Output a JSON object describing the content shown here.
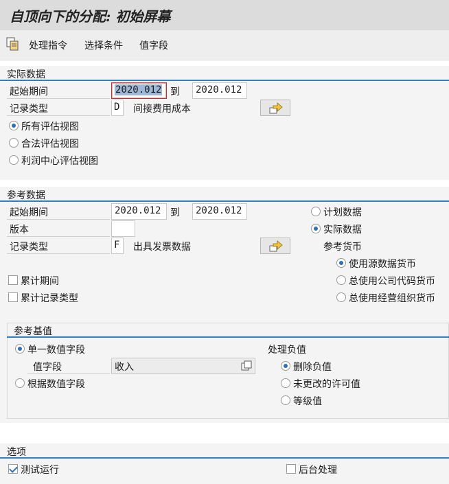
{
  "title": "自顶向下的分配: 初始屏幕",
  "toolbar": {
    "items": [
      "处理指令",
      "选择条件",
      "值字段"
    ]
  },
  "actual": {
    "header": "实际数据",
    "period_label": "起始期间",
    "period_from": "2020.012",
    "to_label": "到",
    "period_to": "2020.012",
    "record_type_label": "记录类型",
    "record_type_value": "D",
    "record_type_desc": "间接费用成本",
    "views": [
      "所有评估视图",
      "合法评估视图",
      "利润中心评估视图"
    ]
  },
  "reference": {
    "header": "参考数据",
    "period_label": "起始期间",
    "period_from": "2020.012",
    "to_label": "到",
    "period_to": "2020.012",
    "version_label": "版本",
    "version_value": "",
    "record_type_label": "记录类型",
    "record_type_value": "F",
    "record_type_desc": "出具发票数据",
    "plan_label": "计划数据",
    "actual_label": "实际数据",
    "currency_header": "参考货币",
    "currency_options": [
      "使用源数据货币",
      "总使用公司代码货币",
      "总使用经营组织货币"
    ],
    "cumulative_period": "累计期间",
    "cumulative_record": "累计记录类型"
  },
  "basis": {
    "header": "参考基值",
    "single_label": "单一数值字段",
    "value_field_label": "值字段",
    "value_field_value": "收入",
    "by_value_label": "根据数值字段",
    "neg_header": "处理负值",
    "neg_options": [
      "删除负值",
      "未更改的许可值",
      "等级值"
    ]
  },
  "options": {
    "header": "选项",
    "test_run": "测试运行",
    "background": "后台处理"
  },
  "colors": {
    "accent": "#2e7fc9",
    "panel": "#f4f4f4"
  }
}
